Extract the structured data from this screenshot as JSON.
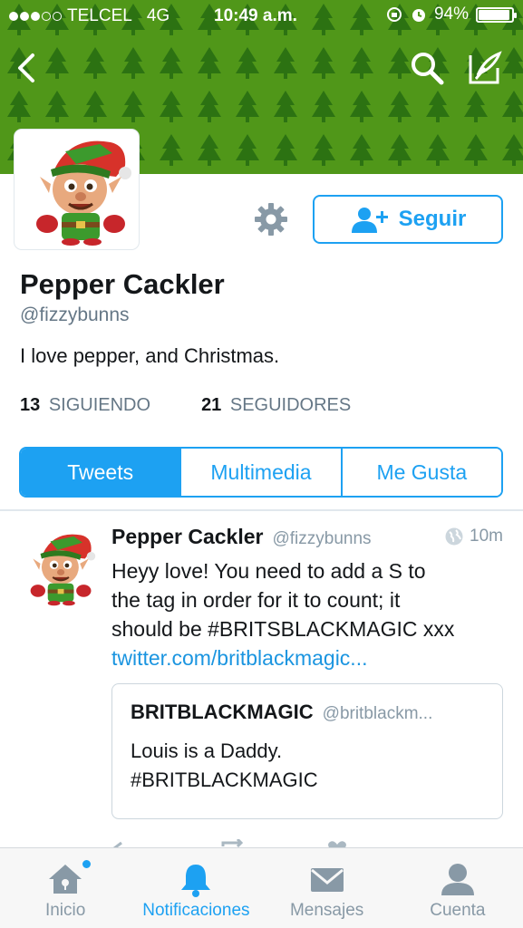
{
  "status_bar": {
    "carrier": "TELCEL",
    "network": "4G",
    "time": "10:49 a.m.",
    "battery": "94%",
    "battery_level": 0.94,
    "signal_bars_filled": 3,
    "signal_bars_total": 5
  },
  "header": {
    "back_icon": "chevron-left-icon",
    "search_icon": "search-icon",
    "compose_icon": "compose-tweet-icon",
    "banner_pattern": "christmas-trees"
  },
  "profile": {
    "name": "Pepper Cackler",
    "handle": "@fizzybunns",
    "bio": "I love pepper, and Christmas.",
    "following_count": "13",
    "following_label": "SIGUIENDO",
    "followers_count": "21",
    "followers_label": "SEGUIDORES",
    "follow_button": "Seguir",
    "settings_icon": "gear-icon"
  },
  "tabs": [
    {
      "label": "Tweets",
      "active": true
    },
    {
      "label": "Multimedia",
      "active": false
    },
    {
      "label": "Me Gusta",
      "active": false
    }
  ],
  "tweet": {
    "name": "Pepper Cackler",
    "handle": "@fizzybunns",
    "time": "10m",
    "line1": "Heyy love! You need to add a S to",
    "line2": "the tag in order for it to count; it",
    "line3": "should be #BRITSBLACKMAGIC xxx",
    "link": "twitter.com/britblackmagic...",
    "quote": {
      "name": "BRITBLACKMAGIC",
      "handle": "@britblackm...",
      "line1": "Louis is a Daddy.",
      "line2": "#BRITBLACKMAGIC"
    }
  },
  "tabbar": [
    {
      "label": "Inicio",
      "icon": "home-icon"
    },
    {
      "label": "Notificaciones",
      "icon": "bell-icon"
    },
    {
      "label": "Mensajes",
      "icon": "envelope-icon"
    },
    {
      "label": "Cuenta",
      "icon": "person-icon"
    }
  ],
  "colors": {
    "accent": "#1da1f2",
    "banner_green": "#4f9a17",
    "tree_green": "#2f7a14"
  }
}
